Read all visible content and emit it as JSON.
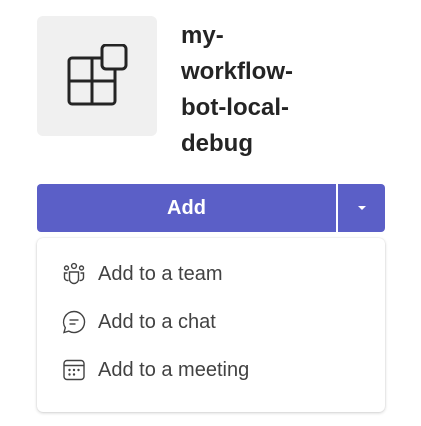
{
  "app": {
    "name": "my-\nworkflow-\nbot-local-\ndebug",
    "icon": "apps-add-icon"
  },
  "add_button": {
    "label": "Add",
    "toggle_icon": "chevron-down-icon"
  },
  "menu": {
    "items": [
      {
        "label": "Add to a team",
        "icon": "people-team-icon"
      },
      {
        "label": "Add to a chat",
        "icon": "chat-icon"
      },
      {
        "label": "Add to a meeting",
        "icon": "calendar-icon"
      }
    ]
  },
  "colors": {
    "brand": "#5b5fc7",
    "icon": "#242424",
    "tile_bg": "#f0f0f0"
  }
}
